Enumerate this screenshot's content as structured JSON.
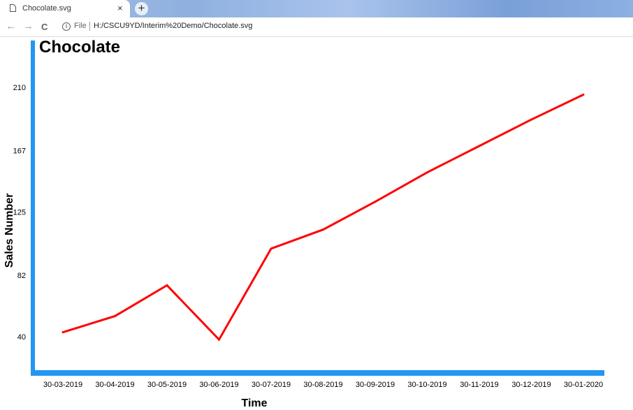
{
  "browser": {
    "tab_title": "Chocolate.svg",
    "close_glyph": "×",
    "new_tab_glyph": "+",
    "back_glyph": "←",
    "forward_glyph": "→",
    "reload_glyph": "C",
    "info_glyph": "i",
    "scheme_label": "File",
    "url": "H:/CSCU9YD/Interim%20Demo/Chocolate.svg"
  },
  "chart_data": {
    "type": "line",
    "title": "Chocolate",
    "xlabel": "Time",
    "ylabel": "Sales Number",
    "categories": [
      "30-03-2019",
      "30-04-2019",
      "30-05-2019",
      "30-06-2019",
      "30-07-2019",
      "30-08-2019",
      "30-09-2019",
      "30-10-2019",
      "30-11-2019",
      "30-12-2019",
      "30-01-2020"
    ],
    "y_ticks": [
      40,
      82,
      125,
      167,
      210
    ],
    "ylim": [
      40,
      210
    ],
    "series": [
      {
        "values": [
          43,
          54,
          75,
          38,
          100,
          113,
          132,
          152,
          170,
          188,
          205
        ],
        "color": "#ff0000"
      }
    ],
    "axis_color": "#2196f3",
    "grid": false
  }
}
